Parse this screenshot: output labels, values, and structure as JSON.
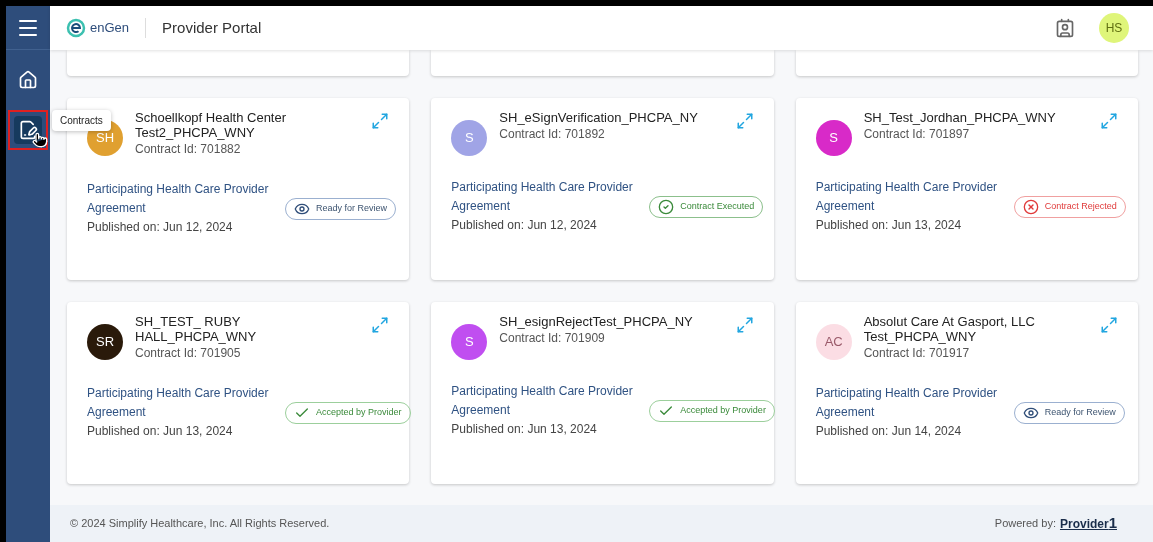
{
  "header": {
    "logo_text": "enGen",
    "title": "Provider Portal",
    "avatar": "HS"
  },
  "sidebar": {
    "items": [
      {
        "kind": "home",
        "selected": false
      },
      {
        "kind": "contracts",
        "selected": true,
        "tooltip": "Contracts"
      }
    ]
  },
  "cards": [
    {
      "avatar": "SH",
      "color": "#e0a030",
      "name": "Schoellkopf Health Center Test2_PHCPA_WNY",
      "contract_id": "Contract Id: 701882",
      "agreement": "Participating Health Care Provider Agreement",
      "published": "Published on: Jun 12, 2024",
      "status": {
        "kind": "review",
        "label": "Ready for Review"
      }
    },
    {
      "avatar": "S",
      "color": "#a0a4e6",
      "name": "SH_eSignVerification_PHCPA_NY",
      "contract_id": "Contract Id: 701892",
      "agreement": "Participating Health Care Provider Agreement",
      "published": "Published on: Jun 12, 2024",
      "status": {
        "kind": "executed",
        "label": "Contract Executed"
      }
    },
    {
      "avatar": "S",
      "color": "#d82ac8",
      "name": "SH_Test_Jordhan_PHCPA_WNY",
      "contract_id": "Contract Id: 701897",
      "agreement": "Participating Health Care Provider Agreement",
      "published": "Published on: Jun 13, 2024",
      "status": {
        "kind": "rejected",
        "label": "Contract Rejected"
      }
    },
    {
      "avatar": "SR",
      "color": "#2a1a0a",
      "name": "SH_TEST_ RUBY HALL_PHCPA_WNY",
      "contract_id": "Contract Id: 701905",
      "agreement": "Participating Health Care Provider Agreement",
      "published": "Published on: Jun 13, 2024",
      "status": {
        "kind": "accepted",
        "label": "Accepted by Provider"
      }
    },
    {
      "avatar": "S",
      "color": "#c04ef0",
      "name": "SH_esignRejectTest_PHCPA_NY",
      "contract_id": "Contract Id: 701909",
      "agreement": "Participating Health Care Provider Agreement",
      "published": "Published on: Jun 13, 2024",
      "status": {
        "kind": "accepted",
        "label": "Accepted by Provider"
      }
    },
    {
      "avatar": "AC",
      "color": "#fbdde4",
      "name": "Absolut Care At Gasport, LLC Test_PHCPA_WNY",
      "contract_id": "Contract Id: 701917",
      "agreement": "Participating Health Care Provider Agreement",
      "published": "Published on: Jun 14, 2024",
      "status": {
        "kind": "review",
        "label": "Ready for Review"
      }
    }
  ],
  "footer": {
    "copyright": "© 2024 Simplify Healthcare, Inc. All Rights Reserved.",
    "powered_by": "Powered by:",
    "brand_name": "Provider",
    "brand_mark": "1"
  }
}
